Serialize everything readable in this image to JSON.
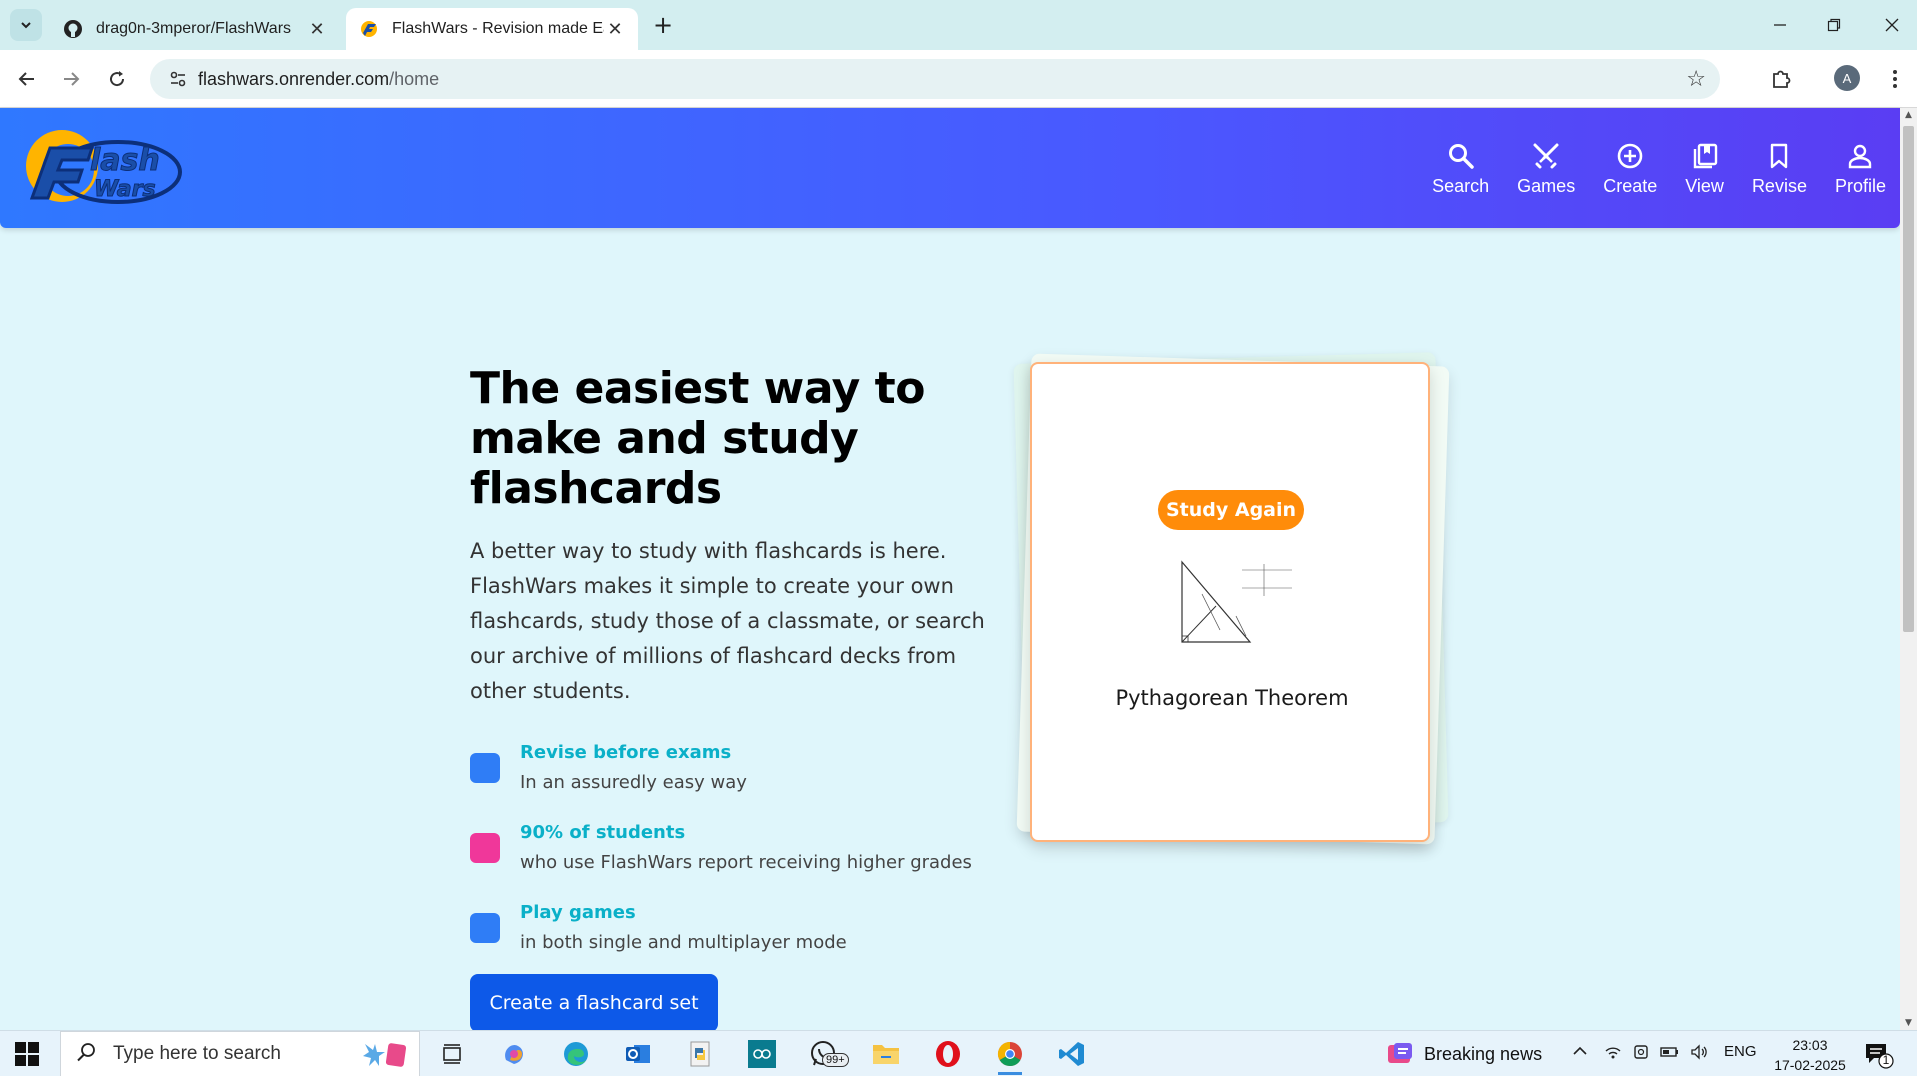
{
  "browser": {
    "tabs": [
      {
        "title": "drag0n-3mperor/FlashWars",
        "active": false,
        "favicon": "github-icon"
      },
      {
        "title": "FlashWars - Revision made Easy",
        "active": true,
        "favicon": "flashwars-favicon"
      }
    ],
    "url_host": "flashwars.onrender.com",
    "url_path": "/home",
    "profile_initial": "A"
  },
  "site": {
    "logo_text_1": "lash",
    "logo_text_2": "Wars",
    "nav": [
      {
        "label": "Search",
        "icon": "search-icon"
      },
      {
        "label": "Games",
        "icon": "swords-icon"
      },
      {
        "label": "Create",
        "icon": "plus-circle-icon"
      },
      {
        "label": "View",
        "icon": "library-icon"
      },
      {
        "label": "Revise",
        "icon": "bookmark-icon"
      },
      {
        "label": "Profile",
        "icon": "person-icon"
      }
    ]
  },
  "hero": {
    "title": "The easiest way to make and study flashcards",
    "description": "A better way to study with flashcards is here. FlashWars makes it simple to create your own flashcards, study those of a classmate, or search our archive of millions of flashcard decks from other students.",
    "features": [
      {
        "title": "Revise before exams",
        "subtitle": "In an assuredly easy way",
        "color": "#2f7df6"
      },
      {
        "title": "90% of students",
        "subtitle": "who use FlashWars report receiving higher grades",
        "color": "#f0379a"
      },
      {
        "title": "Play games",
        "subtitle": "in both single and multiplayer mode",
        "color": "#2f7df6"
      }
    ],
    "cta_label": "Create a flashcard set"
  },
  "card": {
    "badge": "Study Again",
    "title": "Pythagorean Theorem"
  },
  "taskbar": {
    "search_placeholder": "Type here to search",
    "news": "Breaking news",
    "language": "ENG",
    "time": "23:03",
    "date": "17-02-2025",
    "whatsapp_badge": "99+",
    "notification_count": "1"
  },
  "colors": {
    "header_start": "#2f78ff",
    "header_end": "#5a3df3",
    "accent_cyan": "#0ab0c8",
    "cta_blue": "#0d59e8",
    "badge_orange": "#ff8c0a"
  }
}
